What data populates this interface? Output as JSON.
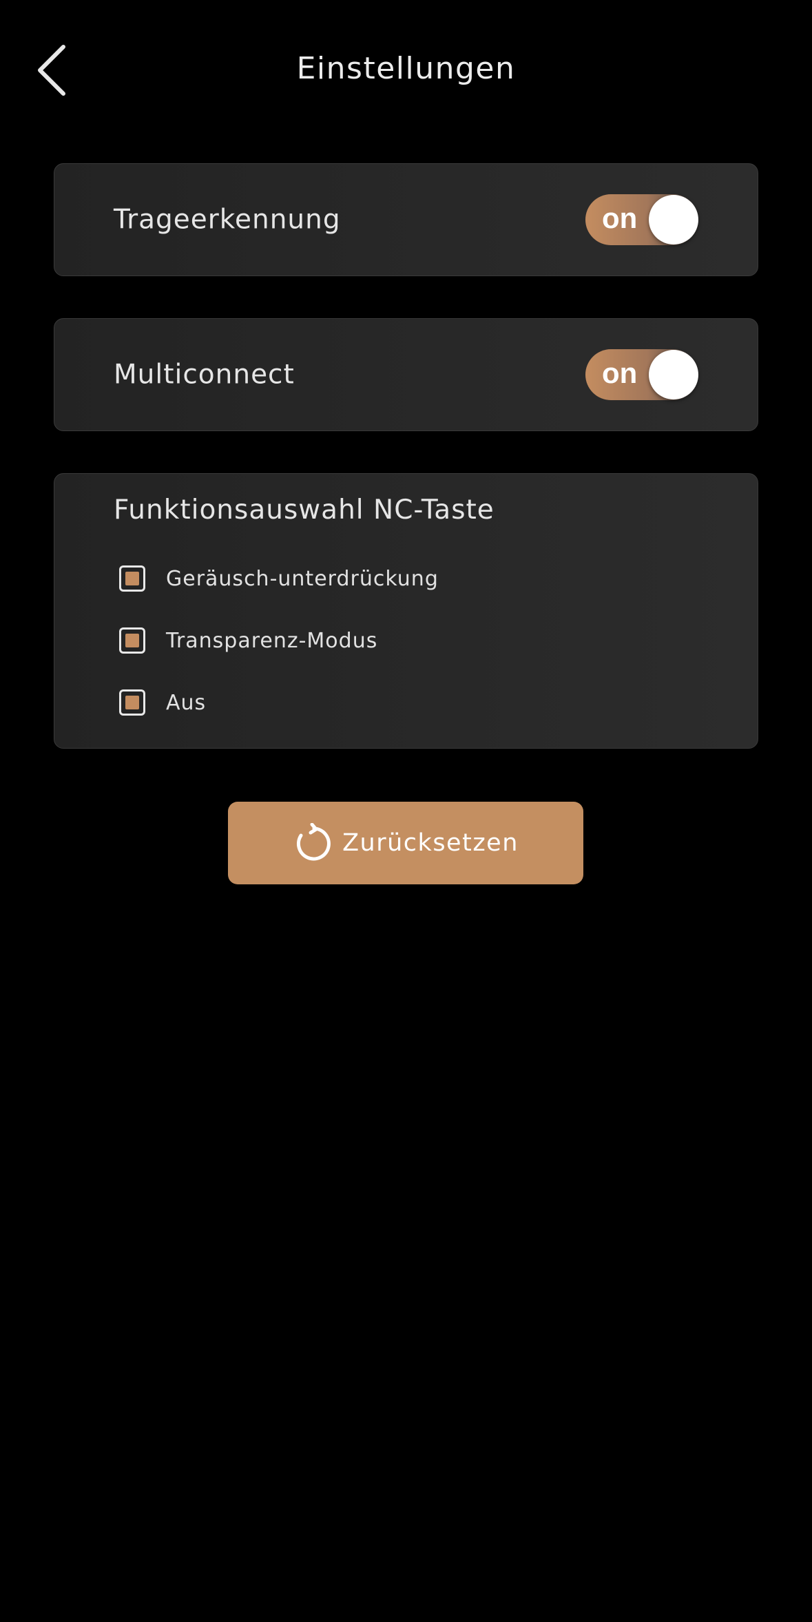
{
  "header": {
    "title": "Einstellungen",
    "back_icon": "chevron-left-icon"
  },
  "settings": {
    "wear_detection": {
      "label": "Trageerkennung",
      "toggle_text": "on",
      "enabled": true
    },
    "multiconnect": {
      "label": "Multiconnect",
      "toggle_text": "on",
      "enabled": true
    }
  },
  "nc_button": {
    "title": "Funktionsauswahl NC-Taste",
    "options": [
      {
        "label": "Geräusch-unterdrückung",
        "checked": true
      },
      {
        "label": "Transparenz-Modus",
        "checked": true
      },
      {
        "label": "Aus",
        "checked": true
      }
    ]
  },
  "reset": {
    "label": "Zurücksetzen",
    "icon": "reset-icon"
  },
  "colors": {
    "accent": "#c48f61",
    "background": "#000000",
    "card": "#2a2a2a",
    "text": "#e8e8e8"
  }
}
